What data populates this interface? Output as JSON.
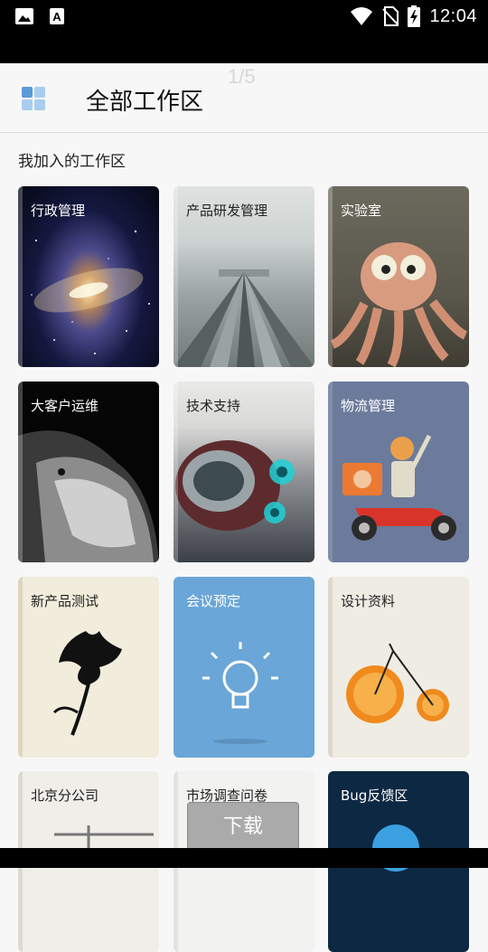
{
  "status_bar": {
    "time": "12:04",
    "left_icons": [
      "image-icon",
      "font-a-icon"
    ],
    "right_icons": [
      "wifi-icon",
      "no-sim-icon",
      "battery-charging-icon"
    ]
  },
  "header": {
    "page_indicator": "1/5",
    "title": "全部工作区",
    "menu_icon": "grid-icon"
  },
  "section": {
    "title": "我加入的工作区"
  },
  "workspaces": [
    {
      "label": "行政管理",
      "image": "galaxy"
    },
    {
      "label": "产品研发管理",
      "image": "monorail-tracks"
    },
    {
      "label": "实验室",
      "image": "octopus-character"
    },
    {
      "label": "大客户运维",
      "image": "lion-head"
    },
    {
      "label": "技术支持",
      "image": "spaceship-engine"
    },
    {
      "label": "物流管理",
      "image": "delivery-scooter"
    },
    {
      "label": "新产品测试",
      "image": "ink-flower"
    },
    {
      "label": "会议预定",
      "image": "lightbulb-icon"
    },
    {
      "label": "设计资料",
      "image": "orange-bicycle"
    },
    {
      "label": "北京分公司",
      "image": "crane"
    },
    {
      "label": "市场调查问卷",
      "image": "misc"
    },
    {
      "label": "Bug反馈区",
      "image": "planet"
    }
  ],
  "download_button": {
    "label": "下载"
  },
  "colors": {
    "accent_blue": "#6aa6d8",
    "grid_icon_dark": "#5b9bd5",
    "grid_icon_light": "#a9cdee"
  }
}
